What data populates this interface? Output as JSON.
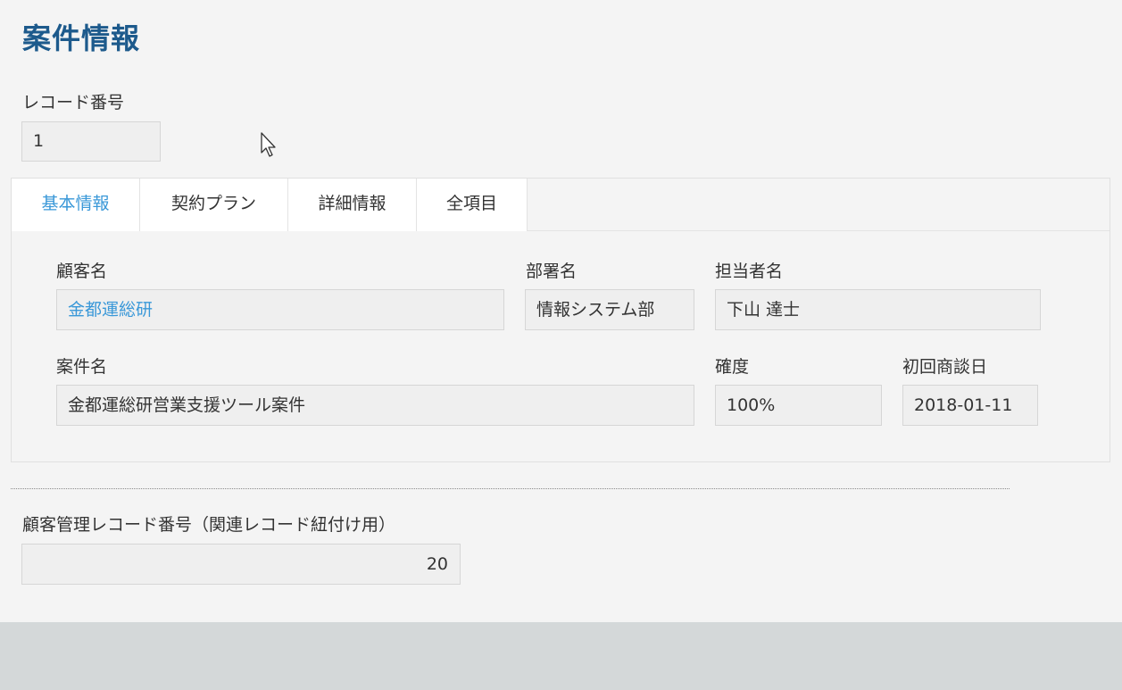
{
  "page_title": "案件情報",
  "record_number": {
    "label": "レコード番号",
    "value": "1"
  },
  "tabs": [
    {
      "label": "基本情報",
      "active": true
    },
    {
      "label": "契約プラン",
      "active": false
    },
    {
      "label": "詳細情報",
      "active": false
    },
    {
      "label": "全項目",
      "active": false
    }
  ],
  "fields": {
    "customer_name": {
      "label": "顧客名",
      "value": "金都運総研"
    },
    "department": {
      "label": "部署名",
      "value": "情報システム部"
    },
    "person_in_charge": {
      "label": "担当者名",
      "value": "下山 達士"
    },
    "project_name": {
      "label": "案件名",
      "value": "金都運総研営業支援ツール案件"
    },
    "probability": {
      "label": "確度",
      "value": "100%"
    },
    "first_meeting_date": {
      "label": "初回商談日",
      "value": "2018-01-11"
    }
  },
  "customer_record_number": {
    "label": "顧客管理レコード番号（関連レコード紐付け用）",
    "value": "20"
  },
  "colors": {
    "title": "#1d5a8c",
    "link": "#3a98d8",
    "background": "#f4f4f4",
    "footer": "#d4d8d9"
  },
  "icons": {
    "cursor": "mouse-pointer-icon"
  }
}
